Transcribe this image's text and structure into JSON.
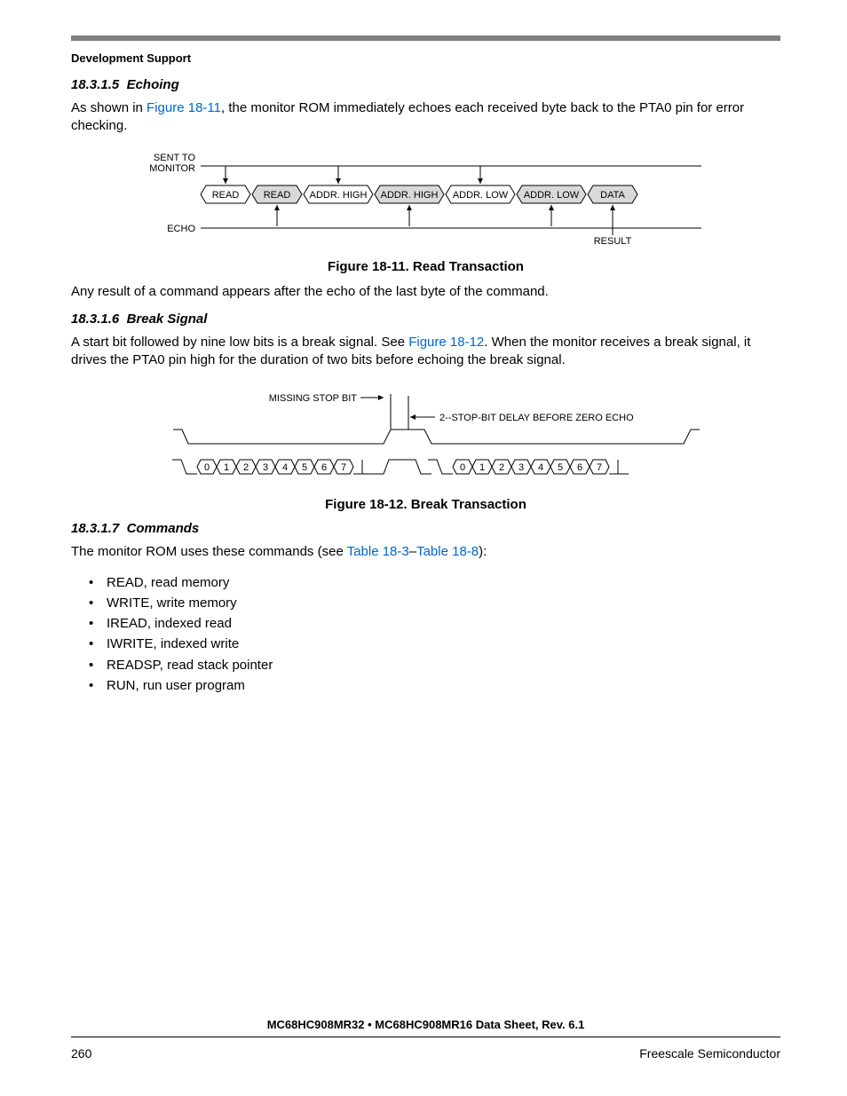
{
  "header": {
    "title": "Development Support"
  },
  "sec1": {
    "num": "18.3.1.5",
    "title": "Echoing",
    "para_pre": "As shown in ",
    "fig_link": "Figure 18-11",
    "para_post": ", the monitor ROM immediately echoes each received byte back to the PTA0 pin for error checking."
  },
  "fig11": {
    "caption": "Figure 18-11. Read Transaction",
    "labels": {
      "sent_line1": "SENT TO",
      "sent_line2": "MONITOR",
      "echo": "ECHO",
      "result": "RESULT"
    },
    "cells": [
      "READ",
      "READ",
      "ADDR. HIGH",
      "ADDR. HIGH",
      "ADDR. LOW",
      "ADDR. LOW",
      "DATA"
    ],
    "after": "Any result of a command appears after the echo of the last byte of the command."
  },
  "sec2": {
    "num": "18.3.1.6",
    "title": "Break Signal",
    "para_pre": "A start bit followed by nine low bits is a break signal. See ",
    "fig_link": "Figure 18-12",
    "para_post": ". When the monitor receives a break signal, it drives the PTA0 pin high for the duration of two bits before echoing the break signal."
  },
  "fig12": {
    "caption": "Figure 18-12. Break Transaction",
    "labels": {
      "missing": "MISSING STOP BIT",
      "delay": "2--STOP-BIT DELAY BEFORE ZERO ECHO"
    },
    "bits_left": [
      "0",
      "1",
      "2",
      "3",
      "4",
      "5",
      "6",
      "7"
    ],
    "bits_right": [
      "0",
      "1",
      "2",
      "3",
      "4",
      "5",
      "6",
      "7"
    ]
  },
  "sec3": {
    "num": "18.3.1.7",
    "title": "Commands",
    "para_pre": "The monitor ROM uses these commands (see ",
    "link1": "Table 18-3",
    "dash": "–",
    "link2": "Table 18-8",
    "para_post": "):",
    "items": [
      "READ, read memory",
      "WRITE, write memory",
      "IREAD, indexed read",
      "IWRITE, indexed write",
      "READSP, read stack pointer",
      "RUN, run user program"
    ]
  },
  "footer": {
    "title": "MC68HC908MR32 • MC68HC908MR16 Data Sheet, Rev. 6.1",
    "page": "260",
    "company": "Freescale Semiconductor"
  }
}
